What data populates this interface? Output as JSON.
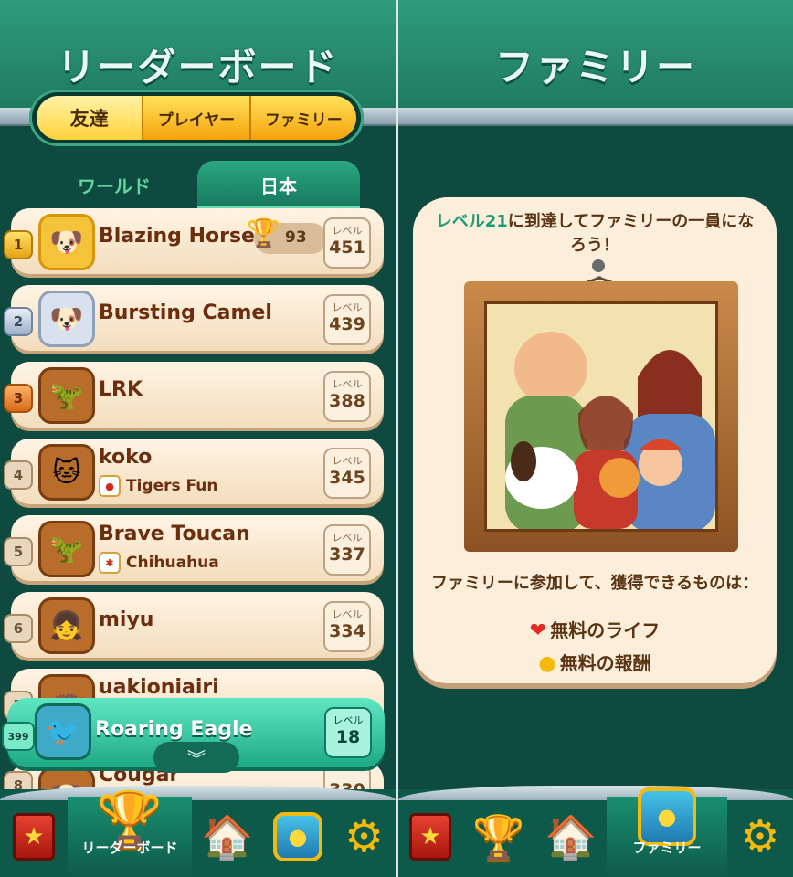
{
  "leaderboard": {
    "title": "リーダーボード",
    "segments": [
      "友達",
      "プレイヤー",
      "ファミリー"
    ],
    "region_tabs": [
      "ワールド",
      "日本"
    ],
    "level_label": "レベル",
    "rows": [
      {
        "rank": "1",
        "name": "Blazing Horse",
        "level": "451",
        "trophies": "93",
        "avatar_icon": "dog"
      },
      {
        "rank": "2",
        "name": "Bursting Camel",
        "level": "439",
        "avatar_icon": "dog"
      },
      {
        "rank": "3",
        "name": "LRK",
        "level": "388",
        "avatar_icon": "dinosaur"
      },
      {
        "rank": "4",
        "name": "koko",
        "team": "Tigers Fun",
        "level": "345",
        "avatar_icon": "cat"
      },
      {
        "rank": "5",
        "name": "Brave Toucan",
        "team": "Chihuahua",
        "level": "337",
        "avatar_icon": "dinosaur"
      },
      {
        "rank": "6",
        "name": "miyu",
        "level": "334",
        "avatar_icon": "girl"
      },
      {
        "rank": "7",
        "name": "uakioniairi",
        "level": "",
        "avatar_icon": "hedgehog"
      },
      {
        "rank": "8",
        "name": "Cougar",
        "level": "330",
        "avatar_icon": "dog"
      }
    ],
    "me": {
      "rank": "399",
      "name": "Roaring Eagle",
      "level": "18",
      "avatar_icon": "bird"
    }
  },
  "family": {
    "title": "ファミリー",
    "card_title_level": "レベル21",
    "card_title_rest": "に到達してファミリーの一員になろう！",
    "benefits_heading": "ファミリーに参加して、獲得できるものは：",
    "benefits": [
      {
        "icon": "heart-icon",
        "label": "無料のライフ"
      },
      {
        "icon": "coin-icon",
        "label": "無料の報酬"
      }
    ]
  },
  "nav": {
    "left": [
      "profile",
      "リーダーボード",
      "house",
      "family",
      "settings"
    ],
    "right": [
      "profile",
      "trophy",
      "house",
      "ファミリー",
      "settings"
    ],
    "left_active_label": "リーダーボード",
    "right_active_label": "ファミリー"
  },
  "colors": {
    "accent_green": "#1a9b74",
    "gold": "#f2b90f",
    "brown_text": "#6b2f0f"
  }
}
